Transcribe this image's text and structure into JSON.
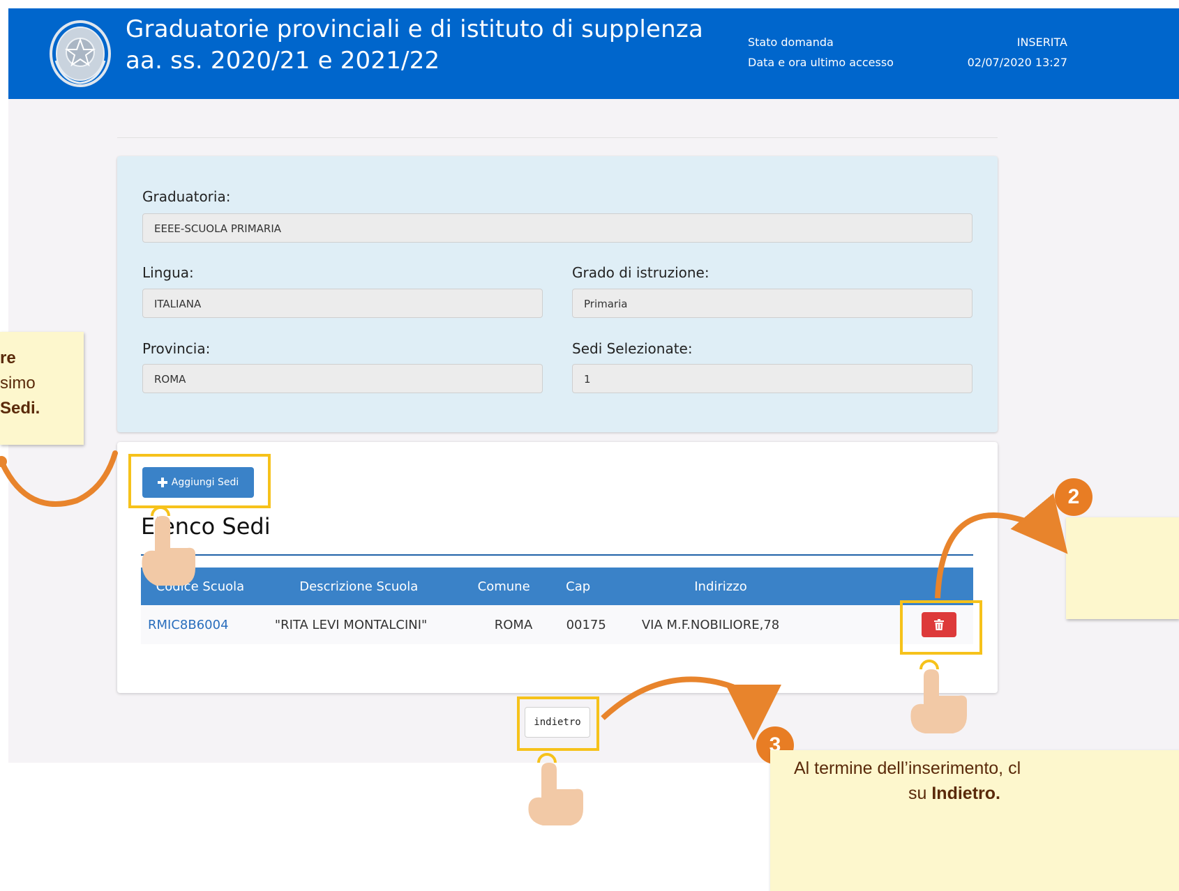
{
  "header": {
    "title_line1": "Graduatorie provinciali e di istituto di supplenza",
    "title_line2": "aa. ss. 2020/21 e 2021/22",
    "status_label": "Stato domanda",
    "status_value": "INSERITA",
    "last_access_label": "Data e ora ultimo accesso",
    "last_access_value": "02/07/2020 13:27",
    "emblem_icon": "italian-republic-emblem-icon"
  },
  "form": {
    "graduatoria_label": "Graduatoria:",
    "graduatoria_value": "EEEE-SCUOLA PRIMARIA",
    "lingua_label": "Lingua:",
    "lingua_value": "ITALIANA",
    "grado_label": "Grado di istruzione:",
    "grado_value": "Primaria",
    "provincia_label": "Provincia:",
    "provincia_value": "ROMA",
    "sedi_label": "Sedi Selezionate:",
    "sedi_value": "1"
  },
  "list": {
    "add_button_label": "Aggiungi Sedi",
    "add_icon": "plus-icon",
    "title": "Elenco Sedi",
    "columns": [
      "Codice Scuola",
      "Descrizione Scuola",
      "Comune",
      "Cap",
      "Indirizzo"
    ],
    "rows": [
      {
        "codice": "RMIC8B6004",
        "descrizione": "\"RITA LEVI MONTALCINI\"",
        "comune": "ROMA",
        "cap": "00175",
        "indirizzo": "VIA M.F.NOBILIORE,78",
        "delete_icon": "trash-icon"
      }
    ]
  },
  "back_button_label": "indietro",
  "annotations": {
    "note1_line1": "re",
    "note1_line2": "simo",
    "note1_line3": "Sedi.",
    "badge2": "2",
    "badge3": "3",
    "note3_line1": "Al termine dell’inserimento, cl",
    "note3_prefix": "su ",
    "note3_bold": "Indietro.",
    "hand_icon": "pointing-hand-icon"
  },
  "colors": {
    "header_bg": "#0066cc",
    "primary_button": "#3a82c8",
    "delete_button": "#dd3a3a",
    "highlight": "#f6c21b",
    "badge": "#e87d24",
    "note_bg": "#fdf7cd"
  }
}
